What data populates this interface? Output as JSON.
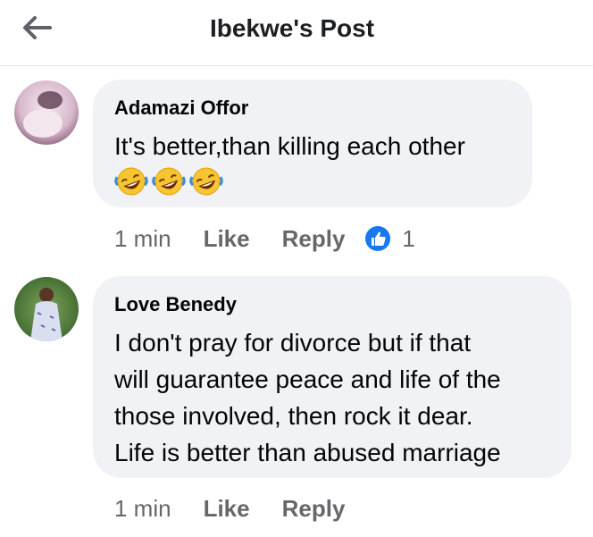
{
  "header": {
    "title": "Ibekwe's Post"
  },
  "comments": [
    {
      "author": "Adamazi Offor",
      "text": "It's better,than killing each other",
      "emojis": [
        "rolling-on-floor-laughing",
        "rolling-on-floor-laughing",
        "rolling-on-floor-laughing"
      ],
      "time": "1 min",
      "like_label": "Like",
      "reply_label": "Reply",
      "reaction_count": "1"
    },
    {
      "author": "Love Benedy",
      "lines": [
        "I don't pray for divorce but if that",
        "will guarantee peace and life of the",
        "those involved, then rock it dear.",
        "Life is better than abused marriage"
      ],
      "time": "1 min",
      "like_label": "Like",
      "reply_label": "Reply"
    }
  ],
  "colors": {
    "meta": "#65676b",
    "bubble": "#f0f2f5",
    "like_blue": "#1877f2"
  }
}
